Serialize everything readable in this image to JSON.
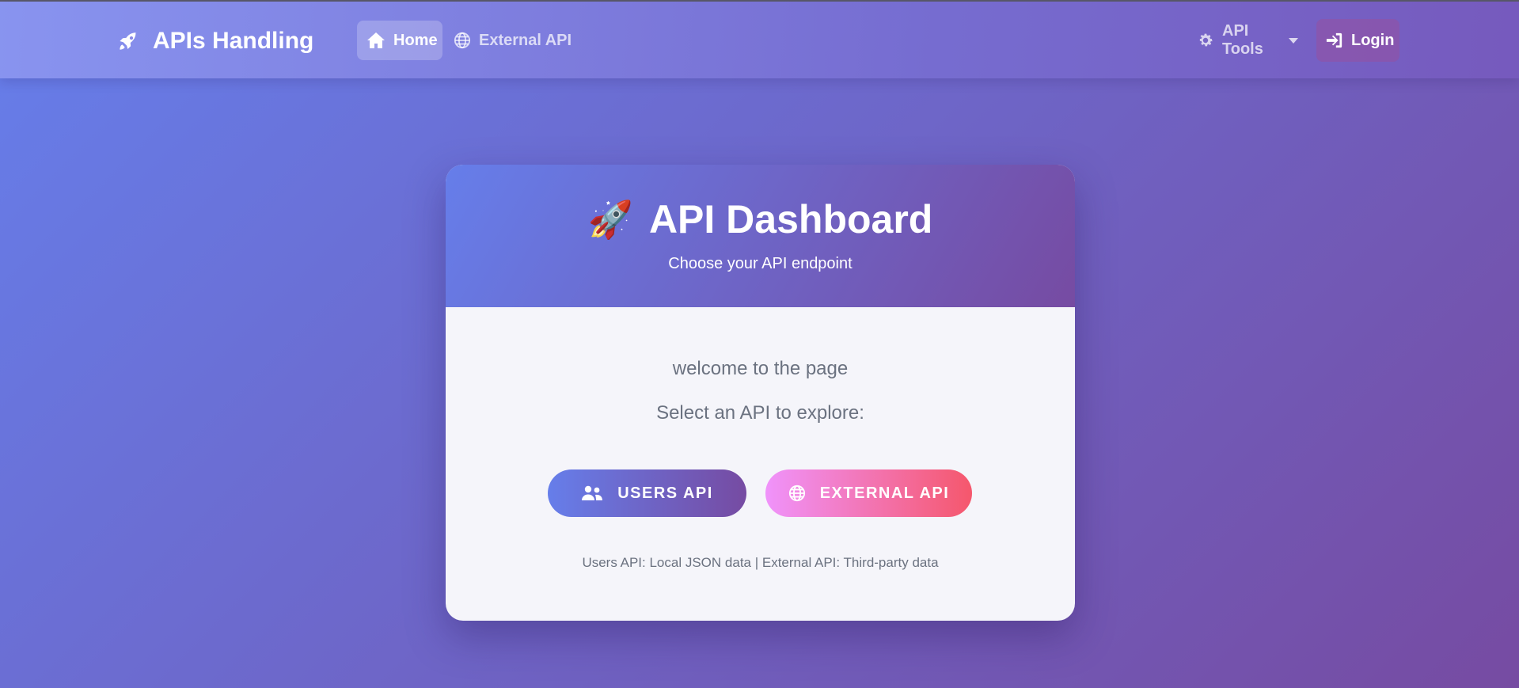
{
  "navbar": {
    "brand": {
      "label": "APIs Handling",
      "icon": "rocket-icon"
    },
    "links": [
      {
        "label": "Home",
        "icon": "home-icon",
        "active": true
      },
      {
        "label": "External API",
        "icon": "globe-icon",
        "active": false
      }
    ],
    "tools": {
      "label": "API Tools",
      "icon": "gear-icon"
    },
    "login": {
      "label": "Login",
      "icon": "sign-in-icon"
    }
  },
  "card": {
    "title": "API Dashboard",
    "title_emoji": "🚀",
    "subtitle": "Choose your API endpoint",
    "welcome": "welcome to the page",
    "prompt": "Select an API to explore:",
    "buttons": {
      "users": {
        "label": "USERS API",
        "icon": "users-icon"
      },
      "external": {
        "label": "EXTERNAL API",
        "icon": "globe-icon"
      }
    },
    "note": "Users API: Local JSON data | External API: Third-party data"
  },
  "colors": {
    "background_start": "#667eea",
    "background_end": "#764ba2",
    "external_button_start": "#f093fb",
    "external_button_end": "#f5576c",
    "muted_text": "#6b7280"
  }
}
